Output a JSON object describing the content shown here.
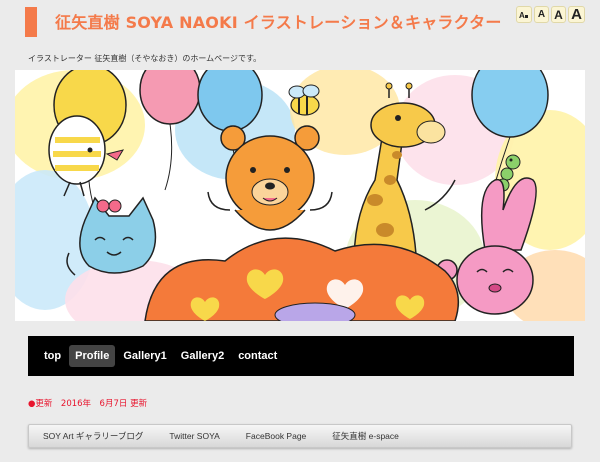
{
  "header": {
    "title": "征矢直樹 SOYA NAOKI イラストレーション＆キャラクター",
    "accent_color": "#f47a4a",
    "font_controls": [
      {
        "label": "A",
        "icon": "font-reset-icon"
      },
      {
        "label": "A"
      },
      {
        "label": "A"
      },
      {
        "label": "A"
      }
    ]
  },
  "tagline": "イラストレーター 征矢直樹（そやなおき）のホームページです。",
  "hero": {
    "alt": "hero-illustration",
    "characters": [
      "bird",
      "bee",
      "bear",
      "giraffe",
      "cat",
      "rabbit",
      "caterpillar"
    ]
  },
  "nav": {
    "items": [
      {
        "label": "top",
        "active": false
      },
      {
        "label": "Profile",
        "active": true
      },
      {
        "label": "Gallery1",
        "active": false
      },
      {
        "label": "Gallery2",
        "active": false
      },
      {
        "label": "contact",
        "active": false
      }
    ]
  },
  "update": "●更新　2016年　6月7日 更新",
  "footer_links": [
    "SOY Art ギャラリーブログ",
    "Twitter SOYA",
    "FaceBook Page",
    "征矢直樹 e-space"
  ]
}
